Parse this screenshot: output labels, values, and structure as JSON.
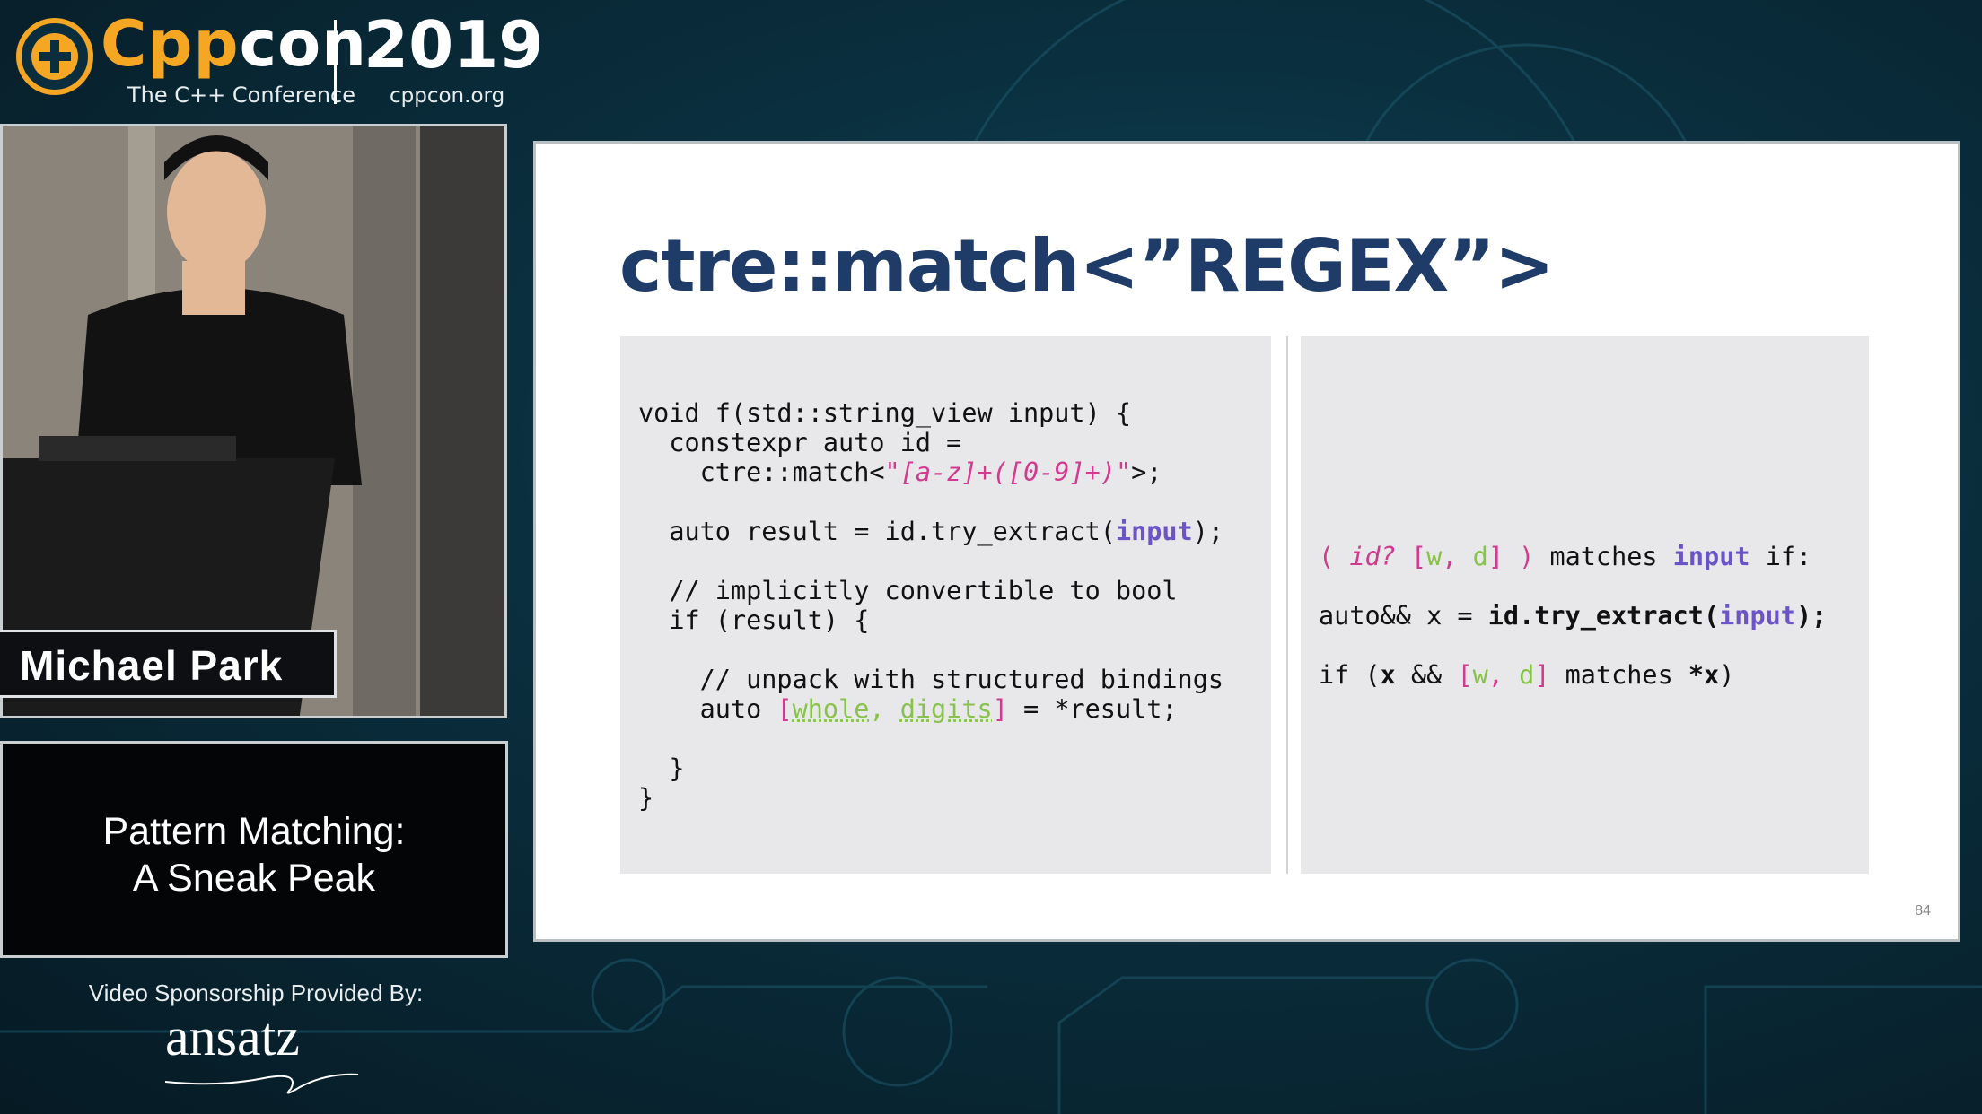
{
  "header": {
    "brand_cpp": "Cpp",
    "brand_con": "con",
    "brand_sub": "The C++ Conference",
    "year": "2019",
    "site": "cppcon.org"
  },
  "speaker": {
    "name": "Michael Park"
  },
  "talk": {
    "title_line1": "Pattern Matching:",
    "title_line2": "A Sneak Peak"
  },
  "sponsor": {
    "label": "Video Sponsorship Provided By:",
    "name": "ansatz"
  },
  "slide": {
    "title": "ctre::match<”REGEX”>",
    "page_number": "84",
    "left_code": {
      "l1": "void f(std::string_view input) {",
      "l2": "  constexpr auto id =",
      "l3a": "    ctre::match<",
      "l3b": "\"",
      "l3c": "[a-z]+([0-9]+)",
      "l3d": "\"",
      "l3e": ">;",
      "l4a": "  auto result = id.try_extract(",
      "l4b": "input",
      "l4c": ");",
      "l5": "  // implicitly convertible to bool",
      "l6": "  if (result) {",
      "l7": "    // unpack with structured bindings",
      "l8a": "    auto ",
      "l8b": "[",
      "l8c": "whole",
      "l8d": ", ",
      "l8e": "digits",
      "l8f": "]",
      "l8g": " = *result;",
      "l9": "  }",
      "l10": "}"
    },
    "right_code": {
      "r1a": "( ",
      "r1b": "id?",
      "r1c": " [",
      "r1d": "w",
      "r1e": ", ",
      "r1f": "d",
      "r1g": "] )",
      "r1h": " matches ",
      "r1i": "input",
      "r1j": " if:",
      "r2a": "auto&& x = ",
      "r2b": "id.try_extract(",
      "r2c": "input",
      "r2d": ");",
      "r3a": "if (",
      "r3b": "x",
      "r3c": " && ",
      "r3d": "[",
      "r3e": "w",
      "r3f": ", ",
      "r3g": "d",
      "r3h": "]",
      "r3i": " matches ",
      "r3j": "*x",
      "r3k": ")"
    }
  },
  "colors": {
    "brand_orange": "#f5a623",
    "title_navy": "#1f3b68",
    "keyword_purple": "#6b54c8",
    "string_pink": "#d23a8e",
    "binding_green": "#88c24a"
  },
  "icons": {
    "logo": "cppcon-plus-logo-icon"
  }
}
